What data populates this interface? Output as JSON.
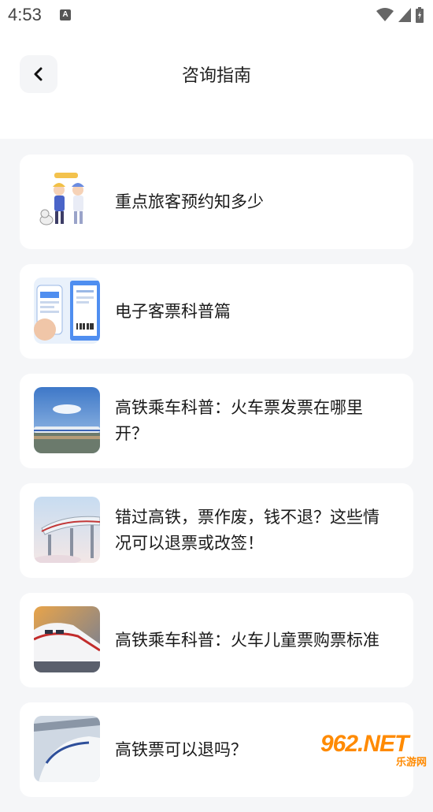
{
  "status": {
    "time": "4:53",
    "notif_glyph": "A"
  },
  "header": {
    "title": "咨询指南",
    "back_icon": "chevron-left-icon"
  },
  "articles": [
    {
      "title": "重点旅客预约知多少",
      "thumb": "travelers-illustration"
    },
    {
      "title": "电子客票科普篇",
      "thumb": "phone-ticket"
    },
    {
      "title": "高铁乘车科普：火车票发票在哪里开？",
      "thumb": "train-sky"
    },
    {
      "title": "错过高铁，票作废，钱不退？这些情况可以退票或改签！",
      "thumb": "train-bridge"
    },
    {
      "title": "高铁乘车科普：火车儿童票购票标准",
      "thumb": "train-closeup"
    },
    {
      "title": "高铁票可以退吗？",
      "thumb": "train-station"
    }
  ],
  "watermark": {
    "main": "962.NET",
    "sub": "乐游网"
  }
}
